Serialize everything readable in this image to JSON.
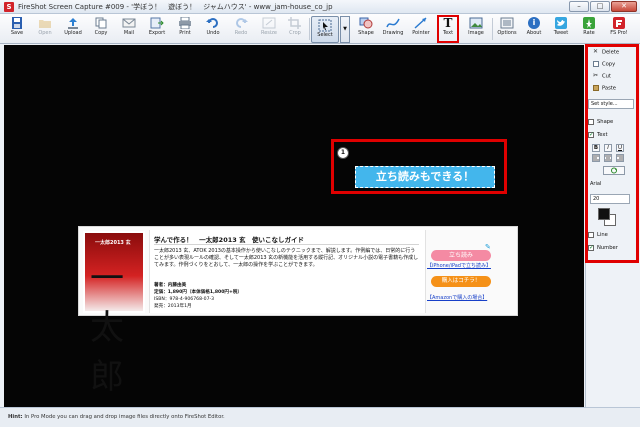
{
  "window": {
    "title": "FireShot Screen Capture #009 - '学ぼう！　遊ぼう！　ジャムハウス' - www_jam-house_co_jp",
    "app_icon": "S",
    "buttons": {
      "minimize": "–",
      "maximize": "□",
      "close": "✕"
    }
  },
  "toolbar": {
    "items": [
      {
        "label": "Save",
        "icon": "save-icon",
        "enabled": true
      },
      {
        "label": "Open",
        "icon": "open-icon",
        "enabled": false
      },
      {
        "label": "Upload",
        "icon": "upload-icon",
        "enabled": true
      },
      {
        "label": "Copy",
        "icon": "copy-icon",
        "enabled": true
      },
      {
        "label": "Mail",
        "icon": "mail-icon",
        "enabled": true
      },
      {
        "label": "Export",
        "icon": "export-icon",
        "enabled": true
      },
      {
        "label": "Print",
        "icon": "print-icon",
        "enabled": true
      },
      {
        "label": "Undo",
        "icon": "undo-icon",
        "enabled": true
      },
      {
        "label": "Redo",
        "icon": "redo-icon",
        "enabled": false
      },
      {
        "label": "Resize",
        "icon": "resize-icon",
        "enabled": false
      },
      {
        "label": "Crop",
        "icon": "crop-icon",
        "enabled": false
      }
    ],
    "select": {
      "label": "Select",
      "icon": "cursor-icon",
      "arrow": "▼"
    },
    "tools": [
      {
        "label": "Shape",
        "icon": "shape-icon"
      },
      {
        "label": "Drawing",
        "icon": "drawing-icon"
      },
      {
        "label": "Pointer",
        "icon": "pointer-icon"
      },
      {
        "label": "Text",
        "icon": "text-icon",
        "glyph": "T"
      },
      {
        "label": "Image",
        "icon": "image-icon"
      }
    ],
    "right": [
      {
        "label": "Options",
        "icon": "options-icon"
      },
      {
        "label": "About",
        "icon": "info-icon",
        "glyph": "i"
      },
      {
        "label": "Tweet",
        "icon": "twitter-icon"
      },
      {
        "label": "Rate",
        "icon": "rate-icon"
      },
      {
        "label": "FS Pro!",
        "icon": "fs-pro-icon"
      }
    ],
    "highlight_color": "#e00000"
  },
  "document": {
    "book": {
      "cover_title": "一太郎2013 玄",
      "cover_brush": "一太郎"
    },
    "heading": "学んで作る！　一太郎2013 玄　使いこなしガイド",
    "description": "一太郎2013 玄、ATOK 2013の基本操作から使いこなしのテクニックまで、解説します。作例編では、日常的に行うことが多い表現ルールの確認、そして一太郎2013 玄の新機能を活用する縦行記、オリジナル小説の電子書籍も作成してみます。作例づくりをとおして、一太郎の操作を学ぶことができます。",
    "author": "著者：内藤由美",
    "price": "定価：1,890円（本体価格1,800円+税）",
    "isbn": "ISBN：978-4-906768-07-3",
    "release": "発売：2013年1月",
    "tachiyomi_button": "立ち読み",
    "iphone_link": "【iPhone/iPadで立ち読み】",
    "buy_button": "購入はコチラ！",
    "amazon_link": "【Amazonで購入の場合】"
  },
  "callout": {
    "number": "1",
    "text": "立ち読みもできる！",
    "color": "#43b6ec"
  },
  "panel": {
    "delete": "Delete",
    "copy": "Copy",
    "cut": "Cut",
    "paste": "Paste",
    "set_style": "Set style...",
    "shape": {
      "label": "Shape",
      "checked": false
    },
    "text": {
      "label": "Text",
      "checked": true
    },
    "bold": "B",
    "italic": "I",
    "underline": "U",
    "font": "Arial",
    "size": "20",
    "line": {
      "label": "Line",
      "checked": false
    },
    "number": {
      "label": "Number",
      "checked": true
    }
  },
  "status": {
    "hint_label": "Hint:",
    "hint_text": "In Pro Mode you can drag and drop image files directly onto FireShot Editor."
  }
}
